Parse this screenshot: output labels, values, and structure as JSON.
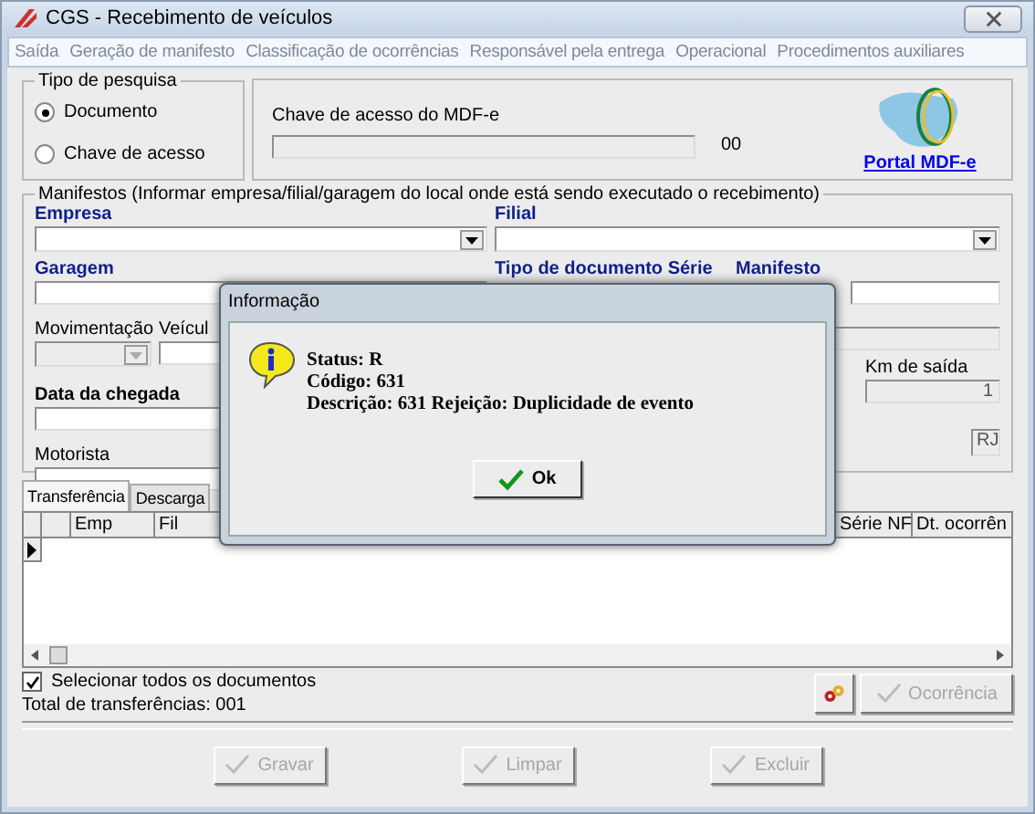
{
  "window": {
    "title": "CGS - Recebimento de veículos"
  },
  "menu": [
    {
      "label": "Saída",
      "disabled": true
    },
    {
      "label": "Geração de manifesto",
      "disabled": true
    },
    {
      "label": "Classificação de ocorrências",
      "disabled": true
    },
    {
      "label": "Responsável pela entrega",
      "disabled": true
    },
    {
      "label": "Operacional",
      "disabled": true
    },
    {
      "label": "Procedimentos auxiliares",
      "disabled": true
    }
  ],
  "search_type": {
    "title": "Tipo de pesquisa",
    "options": [
      {
        "label": "Documento",
        "selected": true
      },
      {
        "label": "Chave de acesso",
        "selected": false
      }
    ]
  },
  "access_key": {
    "label": "Chave de acesso do MDF-e",
    "suffix": "00",
    "portal_link": "Portal MDF-e"
  },
  "manifestos": {
    "title": "Manifestos (Informar empresa/filial/garagem do local onde está sendo executado o recebimento)",
    "empresa_label": "Empresa",
    "filial_label": "Filial",
    "garagem_label": "Garagem",
    "tipo_documento_label": "Tipo de documento Série",
    "manifesto_label": "Manifesto",
    "movimentacao_label": "Movimentação",
    "veiculo_label": "Veícul",
    "data_chegada_label": "Data da chegada",
    "km_saida_label": "Km de saída",
    "km_saida_value": "1",
    "motorista_label": "Motorista",
    "uf_value": "RJ"
  },
  "tabs": [
    {
      "label": "Transferência",
      "selected": true
    },
    {
      "label": "Descarga",
      "selected": false
    }
  ],
  "grid": {
    "columns": [
      "Emp",
      "Fil",
      "Série NF",
      "Dt. ocorrên"
    ]
  },
  "select_all": {
    "label": "Selecionar todos os documentos",
    "checked": true
  },
  "total": "Total de transferências: 001",
  "occurrence_button": {
    "label": "Ocorrência",
    "disabled": true
  },
  "actions": [
    {
      "label": "Gravar",
      "disabled": true
    },
    {
      "label": "Limpar",
      "disabled": true
    },
    {
      "label": "Excluir",
      "disabled": true
    }
  ],
  "dialog": {
    "title": "Informação",
    "lines": [
      "Status: R",
      "Código: 631",
      "Descrição: 631 Rejeição: Duplicidade de evento"
    ],
    "button": "Ok"
  }
}
